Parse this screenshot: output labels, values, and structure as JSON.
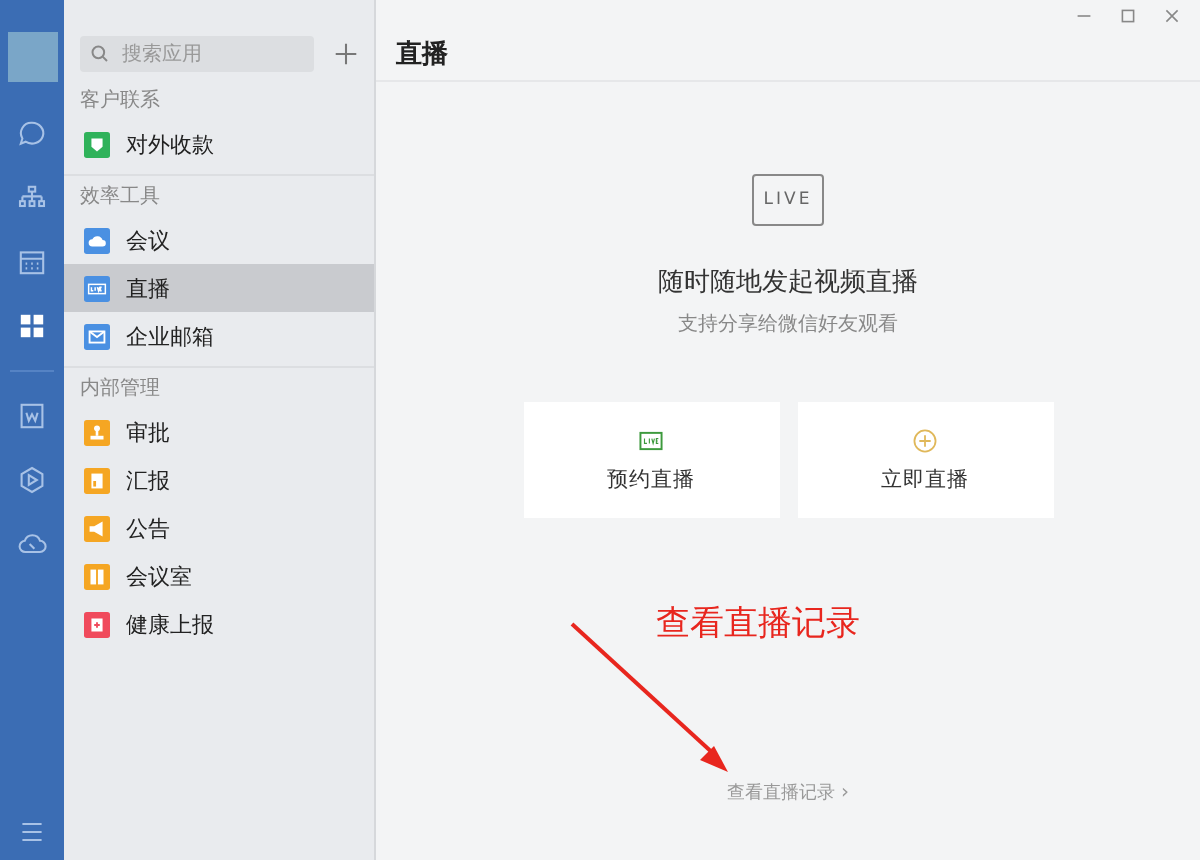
{
  "rail": [
    {
      "kind": "chat",
      "selected": false
    },
    {
      "kind": "org",
      "selected": false
    },
    {
      "kind": "calendar",
      "selected": false
    },
    {
      "kind": "apps",
      "selected": true
    },
    {
      "kind": "doc",
      "selected": false
    },
    {
      "kind": "play",
      "selected": false
    },
    {
      "kind": "cloud",
      "selected": false
    }
  ],
  "search": {
    "placeholder": "搜索应用"
  },
  "sections": [
    {
      "title": "客户联系",
      "items": [
        {
          "label": "对外收款",
          "kind": "shield",
          "color": "#2fb25a",
          "selected": false
        }
      ]
    },
    {
      "title": "效率工具",
      "items": [
        {
          "label": "会议",
          "kind": "cloud",
          "color": "#4a90e2",
          "selected": false
        },
        {
          "label": "直播",
          "kind": "live",
          "color": "#4a90e2",
          "selected": true
        },
        {
          "label": "企业邮箱",
          "kind": "mail",
          "color": "#4a90e2",
          "selected": false
        }
      ]
    },
    {
      "title": "内部管理",
      "items": [
        {
          "label": "审批",
          "kind": "stamp",
          "color": "#f5a623",
          "selected": false
        },
        {
          "label": "汇报",
          "kind": "report",
          "color": "#f5a623",
          "selected": false
        },
        {
          "label": "公告",
          "kind": "horn",
          "color": "#f5a623",
          "selected": false
        },
        {
          "label": "会议室",
          "kind": "door",
          "color": "#f5a623",
          "selected": false
        },
        {
          "label": "健康上报",
          "kind": "health",
          "color": "#f04a5c",
          "selected": false
        }
      ]
    }
  ],
  "page_title": "直播",
  "hero": {
    "badge": "LIVE",
    "heading": "随时随地发起视频直播",
    "subtitle": "支持分享给微信好友观看"
  },
  "cards": [
    {
      "kind": "schedule",
      "label": "预约直播"
    },
    {
      "kind": "start",
      "label": "立即直播"
    }
  ],
  "annotation": "查看直播记录",
  "history_link": {
    "label": "查看直播记录",
    "chevron": "›"
  }
}
